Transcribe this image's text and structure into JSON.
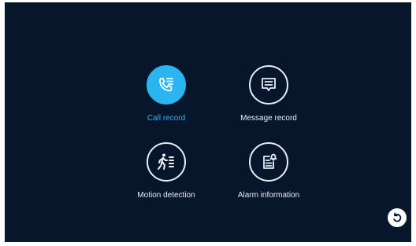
{
  "menu": {
    "items": [
      {
        "label": "Call record",
        "icon": "phone-list-icon",
        "active": true
      },
      {
        "label": "Message record",
        "icon": "message-icon",
        "active": false
      },
      {
        "label": "Motion detection",
        "icon": "walking-person-icon",
        "active": false
      },
      {
        "label": "Alarm information",
        "icon": "alarm-document-icon",
        "active": false
      }
    ]
  },
  "controls": {
    "back_icon": "back-arrow-icon"
  },
  "colors": {
    "background": "#07162b",
    "accent": "#2ab4f0",
    "text": "#e9eef5"
  }
}
